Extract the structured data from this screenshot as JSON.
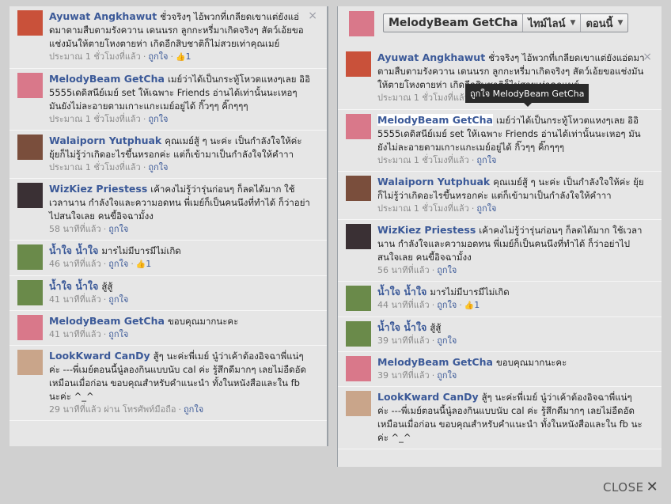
{
  "colors": {
    "link": "#3b5998",
    "meta": "#8b8b8b",
    "panel_bg": "#e6e6e6",
    "page_bg": "#d0d0d0"
  },
  "toolbar": {
    "name": "MelodyBeam GetCha",
    "timeline": "ไทม์ไลน์",
    "now": "ตอนนี้"
  },
  "tooltip": "ถูกใจ MelodyBeam GetCha",
  "close_label": "CLOSE",
  "left_comments": [
    {
      "author": "Ayuwat Angkhawut",
      "text": "ชั่วจริงๆ ไอ้พวกที่เกลียดเขาแต่ยังแอ่ดมาตามสืบตามรังควาน เดนนรก ลูกกะหรี่มาเกิดจริงๆ สัตว์เอ้ยขอแช่งมันให้ตายโหงตายห่า เกิดอีกสิบชาติก็ไม่สวยเท่าคุณเมย์",
      "time": "ประมาณ 1 ชั่วโมงที่แล้ว",
      "like": "ถูกใจ",
      "count": "1",
      "av": "#c9513a",
      "close": true
    },
    {
      "author": "MelodyBeam GetCha",
      "text": "เมย์ว่าได้เป็นกระทู้โหวตแหงๆเลย อิอิ 5555เดดิสนีย์เมย์ set ให้เฉพาะ Friends อ่านได้เท่านั้นนะเหอๆ มันยังไม่ละอายตามเกาะแกะเมย์อยู่ได้ กิ๊วๆๆ คิ๊กๆๆๆ",
      "time": "ประมาณ 1 ชั่วโมงที่แล้ว",
      "like": "ถูกใจ",
      "count": "",
      "av": "#d9788a",
      "close": false
    },
    {
      "author": "Walaiporn Yutphuak",
      "text": "คุณเมย์สู้ ๆ นะค่ะ เป็นกำลังใจให้ค่ะ ยุ้ยก็ไม่รู้ว่าเกิดอะไรขึ้นหรอกค่ะ แต่ก็เข้ามาเป็นกำลังใจให้คําาา",
      "time": "ประมาณ 1 ชั่วโมงที่แล้ว",
      "like": "ถูกใจ",
      "count": "",
      "av": "#7a4e3c",
      "close": false
    },
    {
      "author": "WizKiez Priestess",
      "text": "เค้าคงไม่รู้ว่ารุ่นก่อนๆ ก็ลดได้มาก ใช้เวลานาน กำลังใจและความอดทน พี่เมย์ก็เป็นคนนึงที่ทำได้ ก็ว่าอย่าไปสนใจเลย คนขี้อิจฉามั้งง",
      "time": "58 นาทีที่แล้ว",
      "like": "ถูกใจ",
      "count": "",
      "av": "#3a3034",
      "close": false
    },
    {
      "author": "น้ำใจ น้ำใจ",
      "text": "มารไม่มีบารมีไม่เกิด",
      "time": "46 นาทีที่แล้ว",
      "like": "ถูกใจ",
      "count": "1",
      "av": "#6a8a4a",
      "close": false
    },
    {
      "author": "น้ำใจ น้ำใจ",
      "text": "สู้สู้",
      "time": "41 นาทีที่แล้ว",
      "like": "ถูกใจ",
      "count": "",
      "av": "#6a8a4a",
      "close": false
    },
    {
      "author": "MelodyBeam GetCha",
      "text": "ขอบคุณมากนะคะ",
      "time": "41 นาทีที่แล้ว",
      "like": "ถูกใจ",
      "count": "",
      "av": "#d9788a",
      "close": false
    },
    {
      "author": "LookKward CanDy",
      "text": "สู้ๆ นะค่ะพี่เมย์ นู๋ว่าเค้าต้องอิจฉาพี่แน่ๆ ค่ะ ---พี่เมย์ตอนนี้นู๋ลองกินแบบนับ cal ค่ะ รู้สึกดีมากๆ เลยไม่อืดอัดเหมือนเมื่อก่อน ขอบคุณสำหรับคำแนะนำ ทั้งในหนังสือและใน fb นะค่ะ ^_^",
      "time": "29 นาทีที่แล้ว ผ่าน โทรศัพท์มือถือ",
      "like": "ถูกใจ",
      "count": "",
      "av": "#c9a58a",
      "close": false
    }
  ],
  "right_comments": [
    {
      "author": "Ayuwat Angkhawut",
      "text": "ชั่วจริงๆ ไอ้พวกที่เกลียดเขาแต่ยังแอ่ดมาตามสืบตามรังควาน เดนนรก ลูกกะหรี่มาเกิดจริงๆ สัตว์เอ้ยขอแช่งมันให้ตายโหงตายห่า เกิดอีกสิบชาติก็ไม่สวยเท่าคุณเมย์",
      "time": "ประมาณ 1 ชั่วโมงที่แล้ว",
      "like": "ถูกใจ",
      "count": "1",
      "av": "#c9513a",
      "close": true
    },
    {
      "author": "MelodyBeam GetCha",
      "text": "เมย์ว่าได้เป็นกระทู้โหวตแหงๆเลย อิอิ 5555เดดิสนีย์เมย์ set ให้เฉพาะ Friends อ่านได้เท่านั้นนะเหอๆ มันยังไม่ละอายตามเกาะแกะเมย์อยู่ได้ กิ๊วๆๆ คิ๊กๆๆๆ",
      "time": "ประมาณ 1 ชั่วโมงที่แล้ว",
      "like": "ถูกใจ",
      "count": "",
      "av": "#d9788a",
      "close": false
    },
    {
      "author": "Walaiporn Yutphuak",
      "text": "คุณเมย์สู้ ๆ นะค่ะ เป็นกำลังใจให้ค่ะ ยุ้ยก็ไม่รู้ว่าเกิดอะไรขึ้นหรอกค่ะ แต่ก็เข้ามาเป็นกำลังใจให้คําาา",
      "time": "ประมาณ 1 ชั่วโมงที่แล้ว",
      "like": "ถูกใจ",
      "count": "",
      "av": "#7a4e3c",
      "close": false
    },
    {
      "author": "WizKiez Priestess",
      "text": "เค้าคงไม่รู้ว่ารุ่นก่อนๆ ก็ลดได้มาก ใช้เวลานาน กำลังใจและความอดทน พี่เมย์ก็เป็นคนนึงที่ทำได้ ก็ว่าอย่าไปสนใจเลย คนขี้อิจฉามั้งง",
      "time": "56 นาทีที่แล้ว",
      "like": "ถูกใจ",
      "count": "",
      "av": "#3a3034",
      "close": false
    },
    {
      "author": "น้ำใจ น้ำใจ",
      "text": "มารไม่มีบารมีไม่เกิด",
      "time": "44 นาทีที่แล้ว",
      "like": "ถูกใจ",
      "count": "1",
      "av": "#6a8a4a",
      "close": false
    },
    {
      "author": "น้ำใจ น้ำใจ",
      "text": "สู้สู้",
      "time": "39 นาทีที่แล้ว",
      "like": "ถูกใจ",
      "count": "",
      "av": "#6a8a4a",
      "close": false
    },
    {
      "author": "MelodyBeam GetCha",
      "text": "ขอบคุณมากนะคะ",
      "time": "39 นาทีที่แล้ว",
      "like": "ถูกใจ",
      "count": "",
      "av": "#d9788a",
      "close": false
    },
    {
      "author": "LookKward CanDy",
      "text": "สู้ๆ นะค่ะพี่เมย์ นู๋ว่าเค้าต้องอิจฉาพี่แน่ๆ ค่ะ ---พี่เมย์ตอนนี้นู๋ลองกินแบบนับ cal ค่ะ รู้สึกดีมากๆ เลยไม่อืดอัดเหมือนเมื่อก่อน ขอบคุณสำหรับคำแนะนำ ทั้งในหนังสือและใน fb นะค่ะ ^_^",
      "time": "",
      "like": "",
      "count": "",
      "av": "#c9a58a",
      "close": false
    }
  ]
}
